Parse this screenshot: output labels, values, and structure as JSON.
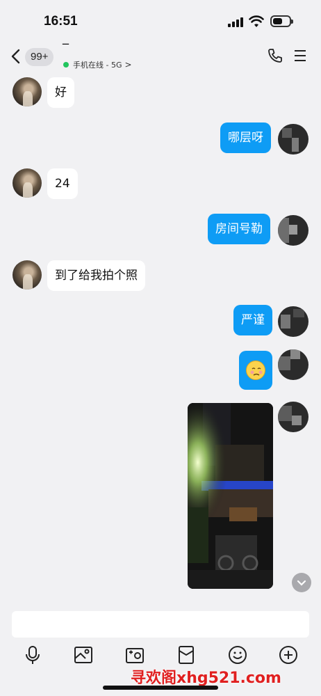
{
  "status_bar": {
    "time": "16:51"
  },
  "header": {
    "unread_badge": "99+",
    "contact_name": "‾",
    "online_status": "手机在线 - 5G",
    "chevron": ">"
  },
  "messages": [
    {
      "side": "left",
      "text": "好"
    },
    {
      "side": "right",
      "text": "哪层呀"
    },
    {
      "side": "left",
      "text": "24"
    },
    {
      "side": "right",
      "text": "房间号勒"
    },
    {
      "side": "left",
      "text": "到了给我拍个照"
    },
    {
      "side": "right",
      "text": "严谨"
    },
    {
      "side": "right",
      "type": "sticker",
      "icon": "shy-face-emoji"
    },
    {
      "side": "right",
      "type": "image",
      "description_icon": "night-street-photo"
    }
  ],
  "input": {
    "value": "",
    "placeholder": ""
  },
  "toolbar": [
    "microphone-icon",
    "image-icon",
    "camera-icon",
    "red-packet-icon",
    "emoji-icon",
    "plus-icon"
  ],
  "watermark": "寻欢阁xhg521.com",
  "colors": {
    "bubble_out": "#0e9cf5",
    "bubble_in": "#ffffff",
    "background": "#f1f1f3",
    "online_dot": "#22c55e",
    "watermark": "#e02020"
  }
}
